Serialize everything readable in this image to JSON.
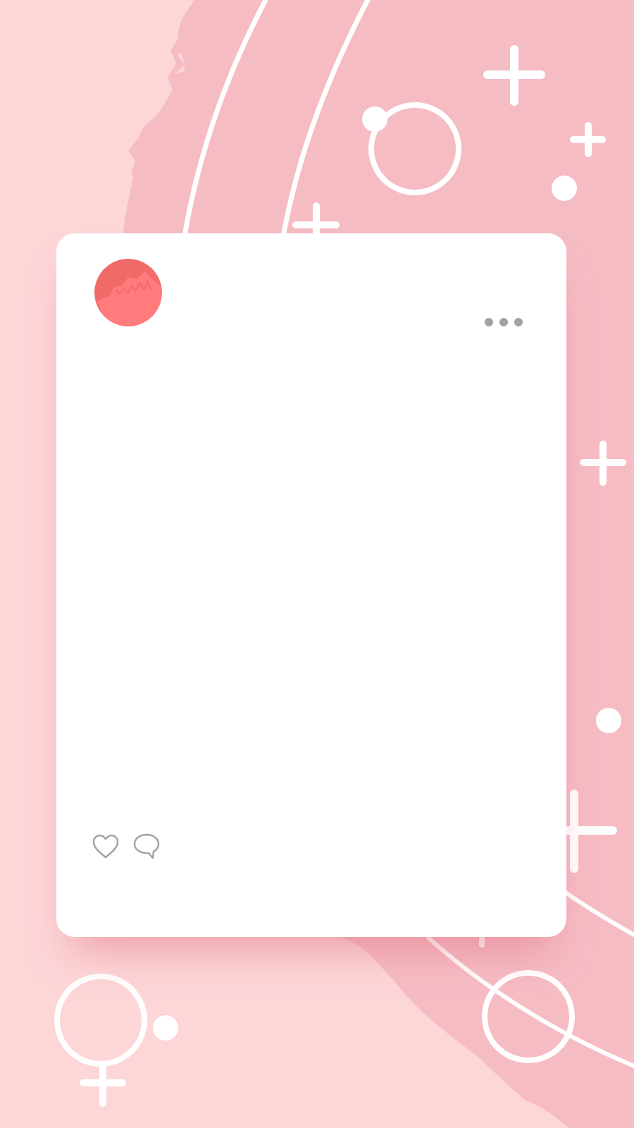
{
  "theme": {
    "page_background": "#fdd6d8",
    "brush_stroke": "#f6bcc4",
    "decoration": "#ffffff",
    "card_background": "#ffffff",
    "icon_gray": "#a3a3a3",
    "avatar_colors": [
      "#f06a6a",
      "#ff7b7c"
    ]
  },
  "post": {
    "avatar_icon": "profile-avatar-icon",
    "more_icon": "more-options-icon",
    "actions": [
      {
        "icon": "heart-icon",
        "name": "like"
      },
      {
        "icon": "comment-bubble-icon",
        "name": "comment"
      }
    ]
  },
  "decorations": {
    "icons": [
      "plus-icon",
      "circle-icon",
      "dot-icon",
      "female-symbol-icon"
    ]
  }
}
